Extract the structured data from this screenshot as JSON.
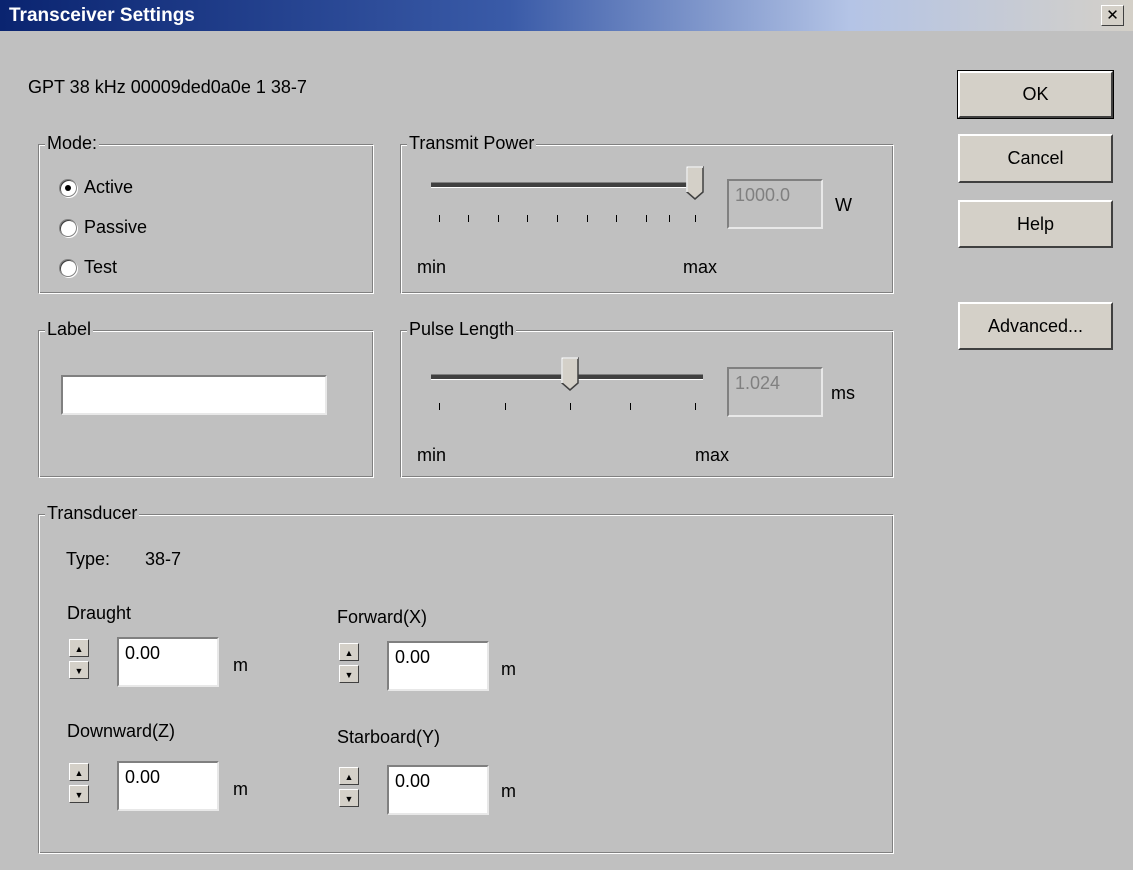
{
  "window": {
    "title": "Transceiver Settings",
    "close_glyph": "✕"
  },
  "device_info": "GPT  38 kHz 00009ded0a0e 1 38-7",
  "mode": {
    "label": "Mode:",
    "options": [
      {
        "label": "Active",
        "checked": true
      },
      {
        "label": "Passive",
        "checked": false
      },
      {
        "label": "Test",
        "checked": false
      }
    ]
  },
  "transmit_power": {
    "label": "Transmit Power",
    "value": "1000.0",
    "unit": "W",
    "min_label": "min",
    "max_label": "max",
    "slider_fraction": 1.0
  },
  "label_group": {
    "label": "Label",
    "value": ""
  },
  "pulse_length": {
    "label": "Pulse Length",
    "value": "1.024",
    "unit": "ms",
    "min_label": "min",
    "max_label": "max",
    "slider_fraction": 0.5
  },
  "transducer": {
    "label": "Transducer",
    "type_label": "Type:",
    "type_value": "38-7",
    "fields": {
      "draught": {
        "label": "Draught",
        "value": "0.00",
        "unit": "m"
      },
      "forward": {
        "label": "Forward(X)",
        "value": "0.00",
        "unit": "m"
      },
      "downward": {
        "label": "Downward(Z)",
        "value": "0.00",
        "unit": "m"
      },
      "starboard": {
        "label": "Starboard(Y)",
        "value": "0.00",
        "unit": "m"
      }
    }
  },
  "buttons": {
    "ok": "OK",
    "cancel": "Cancel",
    "help": "Help",
    "advanced": "Advanced..."
  },
  "icons": {
    "spin_up": "▲",
    "spin_down": "▼"
  },
  "colors": {
    "dialog_bg": "#c0c0c0",
    "title_start": "#0a2470",
    "title_end": "#d4d0c8"
  }
}
